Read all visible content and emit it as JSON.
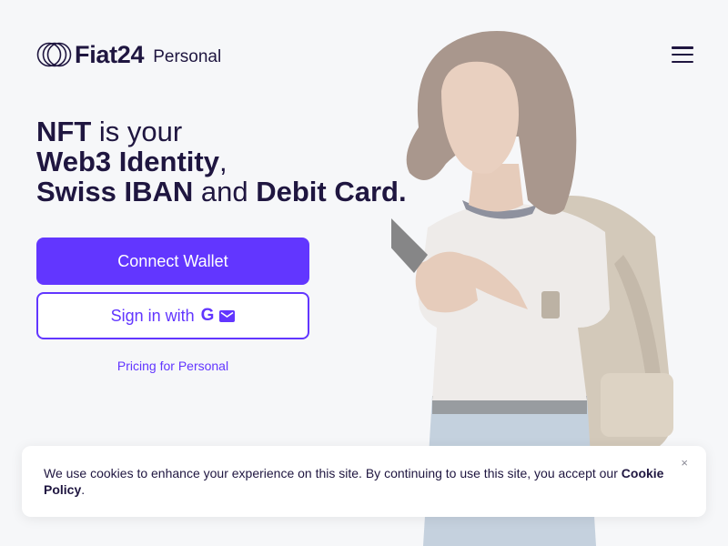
{
  "brand": {
    "name": "Fiat24",
    "sub": "Personal"
  },
  "header": {
    "menu_icon": "hamburger-menu-icon"
  },
  "hero": {
    "line1_bold": "NFT",
    "line1_rest": " is your",
    "line2_bold": "Web3 Identity",
    "line2_rest": ",",
    "line3_bold_a": "Swiss IBAN",
    "line3_mid": " and ",
    "line3_bold_b": "Debit Card."
  },
  "actions": {
    "connect_wallet": "Connect Wallet",
    "sign_in_with": "Sign in with",
    "google_glyph": "G",
    "google_icon": "google-icon",
    "mail_icon": "mail-icon",
    "pricing": "Pricing for Personal"
  },
  "cookie": {
    "text": "We use cookies to enhance your experience on this site. By continuing to use this site, you accept our ",
    "link": "Cookie Policy",
    "suffix": ".",
    "close": "×"
  },
  "colors": {
    "accent": "#6236ff",
    "text": "#1f1640",
    "background": "#f6f7f9"
  }
}
